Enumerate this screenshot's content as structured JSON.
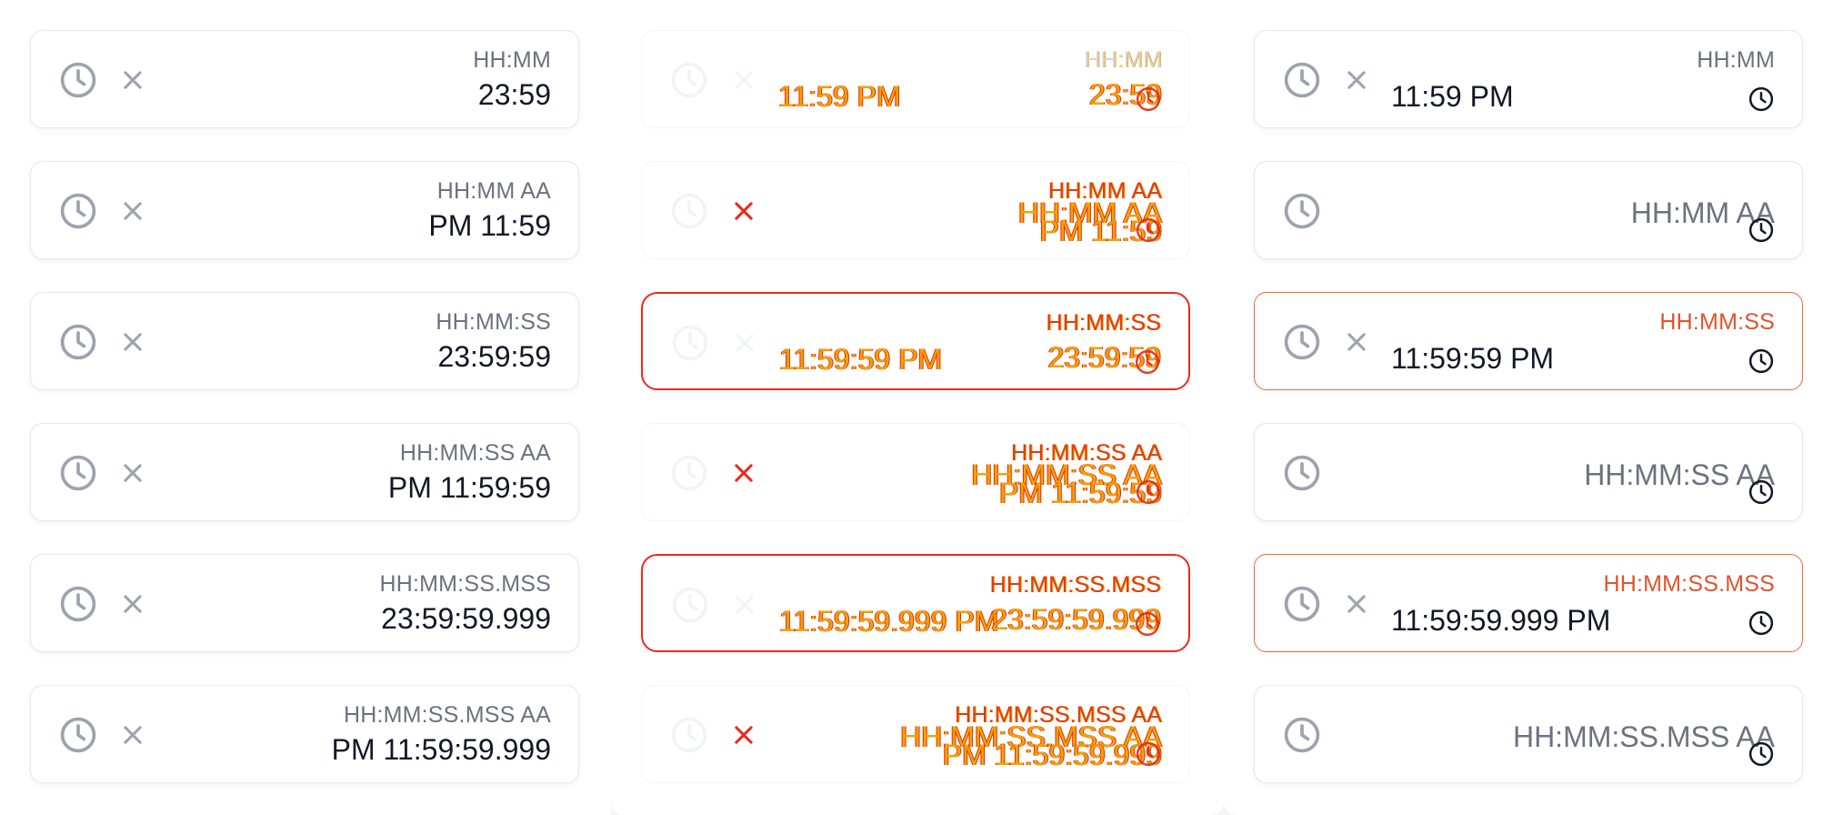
{
  "columns": [
    {
      "rows": [
        {
          "label": "HH:MM",
          "value": "23:59"
        },
        {
          "label": "HH:MM AA",
          "value": "PM 11:59"
        },
        {
          "label": "HH:MM:SS",
          "value": "23:59:59"
        },
        {
          "label": "HH:MM:SS AA",
          "value": "PM 11:59:59"
        },
        {
          "label": "HH:MM:SS.MSS",
          "value": "23:59:59.999"
        },
        {
          "label": "HH:MM:SS.MSS AA",
          "value": "PM 11:59:59.999"
        }
      ]
    },
    {
      "rows": [
        {
          "label": "HH:MM",
          "value": "23:59",
          "left_value": "11:59 PM"
        },
        {
          "label": "HH:MM AA",
          "value": "PM 11:59",
          "placeholder": "HH:MM AA"
        },
        {
          "label": "HH:MM:SS",
          "value": "23:59:59",
          "left_value": "11:59:59 PM"
        },
        {
          "label": "HH:MM:SS AA",
          "value": "PM 11:59:59",
          "placeholder": "HH:MM:SS AA"
        },
        {
          "label": "HH:MM:SS.MSS",
          "value": "23:59:59.999",
          "left_value": "11:59:59.999 PM"
        },
        {
          "label": "HH:MM:SS.MSS AA",
          "value": "PM 11:59:59.999",
          "placeholder": "HH:MM:SS.MSS AA"
        }
      ]
    },
    {
      "rows": [
        {
          "label": "HH:MM",
          "left_value": "11:59 PM"
        },
        {
          "placeholder": "HH:MM AA"
        },
        {
          "label": "HH:MM:SS",
          "left_value": "11:59:59 PM"
        },
        {
          "placeholder": "HH:MM:SS AA"
        },
        {
          "label": "HH:MM:SS.MSS",
          "left_value": "11:59:59.999 PM"
        },
        {
          "placeholder": "HH:MM:SS.MSS AA"
        }
      ]
    }
  ],
  "colors": {
    "error_border": "#ef6a3c",
    "label_gray": "#6b7280",
    "text": "#111827",
    "glitch_orange": "#f5a300",
    "glitch_red": "#e02b10"
  }
}
